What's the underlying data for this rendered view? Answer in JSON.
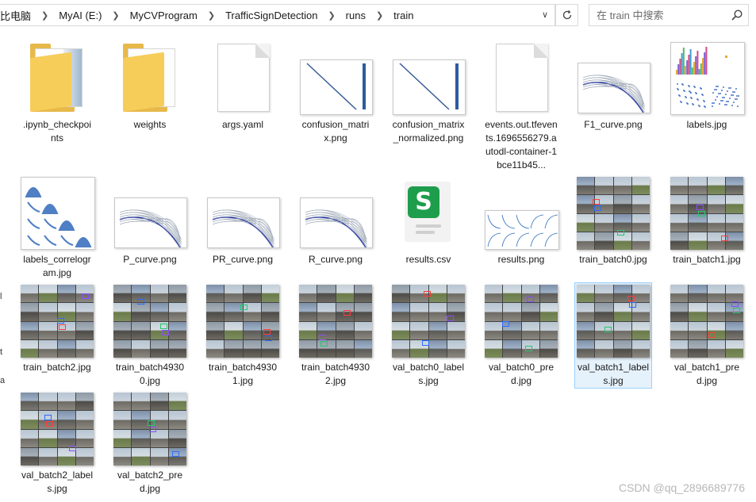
{
  "breadcrumb": {
    "items": [
      "比电脑",
      "MyAI (E:)",
      "MyCVProgram",
      "TrafficSignDetection",
      "runs",
      "train"
    ]
  },
  "search": {
    "placeholder": "在 train 中搜索"
  },
  "left_edge_labels": [
    "l",
    "t",
    "a"
  ],
  "files": [
    {
      "name": ".ipynb_checkpoints",
      "type": "folder-notebook"
    },
    {
      "name": "weights",
      "type": "folder"
    },
    {
      "name": "args.yaml",
      "type": "doc"
    },
    {
      "name": "confusion_matrix.png",
      "type": "confusion"
    },
    {
      "name": "confusion_matrix_normalized.png",
      "type": "confusion"
    },
    {
      "name": "events.out.tfevents.1696556279.autodl-container-1bce11b45...",
      "type": "doc"
    },
    {
      "name": "F1_curve.png",
      "type": "curve"
    },
    {
      "name": "labels.jpg",
      "type": "labels"
    },
    {
      "name": "labels_correlogram.jpg",
      "type": "correlogram"
    },
    {
      "name": "P_curve.png",
      "type": "curve"
    },
    {
      "name": "PR_curve.png",
      "type": "curve"
    },
    {
      "name": "R_curve.png",
      "type": "curve"
    },
    {
      "name": "results.csv",
      "type": "csv",
      "badge": "S"
    },
    {
      "name": "results.png",
      "type": "results"
    },
    {
      "name": "train_batch0.jpg",
      "type": "photos"
    },
    {
      "name": "train_batch1.jpg",
      "type": "photos"
    },
    {
      "name": "train_batch2.jpg",
      "type": "photos"
    },
    {
      "name": "train_batch49300.jpg",
      "type": "photos-dark"
    },
    {
      "name": "train_batch49301.jpg",
      "type": "photos-dark"
    },
    {
      "name": "train_batch49302.jpg",
      "type": "photos-dark"
    },
    {
      "name": "val_batch0_labels.jpg",
      "type": "photos"
    },
    {
      "name": "val_batch0_pred.jpg",
      "type": "photos"
    },
    {
      "name": "val_batch1_labels.jpg",
      "type": "photos",
      "selected": true
    },
    {
      "name": "val_batch1_pred.jpg",
      "type": "photos"
    },
    {
      "name": "val_batch2_labels.jpg",
      "type": "photos"
    },
    {
      "name": "val_batch2_pred.jpg",
      "type": "photos"
    }
  ],
  "watermark": "CSDN @qq_2896689776",
  "colors": {
    "folder": "#f6cd59",
    "selection": "#e5f1fb",
    "selection_border": "#99d1ff",
    "csv_badge": "#1e9e4c"
  }
}
